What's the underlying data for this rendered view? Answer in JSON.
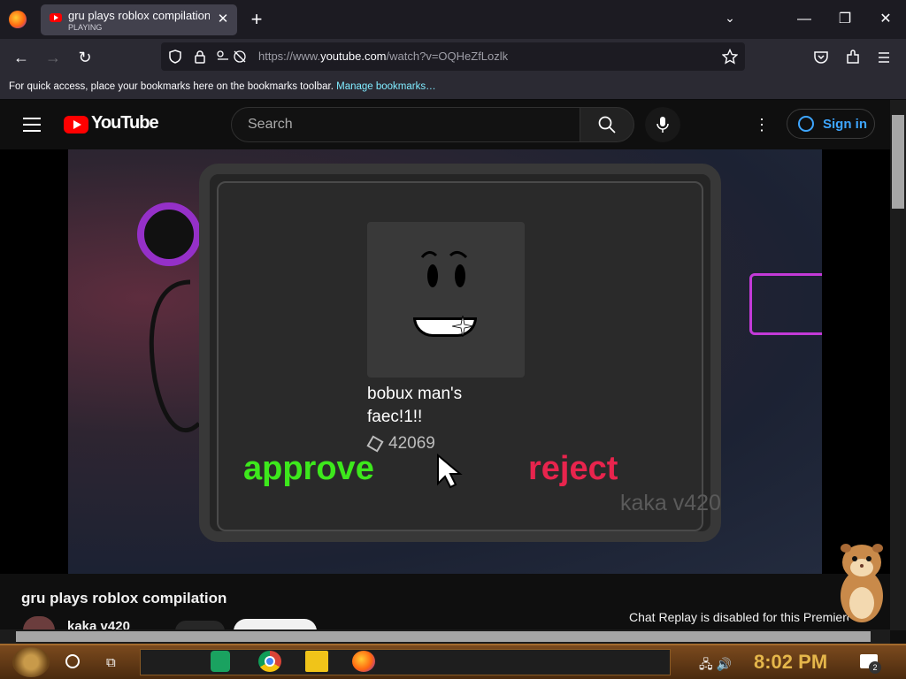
{
  "browser": {
    "tab": {
      "title": "gru plays roblox compilation - YouTube",
      "status": "PLAYING",
      "close": "✕"
    },
    "new_tab": "+",
    "tab_list": "⌄",
    "window": {
      "minimize": "—",
      "restore": "❐",
      "close": "✕"
    },
    "nav": {
      "back": "←",
      "forward": "→",
      "reload": "↻"
    },
    "url": {
      "prefix": "https://www.",
      "domain": "youtube.com",
      "path": "/watch?v=OQHeZfLozlk"
    },
    "icons": [
      "shield-icon",
      "lock-icon",
      "permissions-icon",
      "star-icon",
      "pocket-icon",
      "extensions-icon",
      "hamburger-menu-icon"
    ],
    "bookmarks_bar": {
      "text": "For quick access, place your bookmarks here on the bookmarks toolbar.",
      "link": "Manage bookmarks…"
    }
  },
  "youtube": {
    "logo_text": "YouTube",
    "search_placeholder": "Search",
    "signin_label": "Sign in",
    "kebab": "⋮"
  },
  "video": {
    "item_name_line1": "bobux man's",
    "item_name_line2": "faec!1!!",
    "price": "42069",
    "approve": "approve",
    "reject": "reject",
    "watermark": "kaka v420"
  },
  "below": {
    "title": "gru plays roblox compilation",
    "channel": "kaka v420",
    "chat_note": "Chat Replay is disabled for this Premiere."
  },
  "taskbar": {
    "time": "8:02 PM",
    "notifications": "2",
    "apps": [
      "sheets-icon",
      "chrome-icon",
      "file-explorer-icon",
      "firefox-icon"
    ]
  },
  "colors": {
    "approve": "#3de81c",
    "reject": "#e8244d",
    "link": "#3ea6ff",
    "youtube_red": "#ff0000"
  }
}
